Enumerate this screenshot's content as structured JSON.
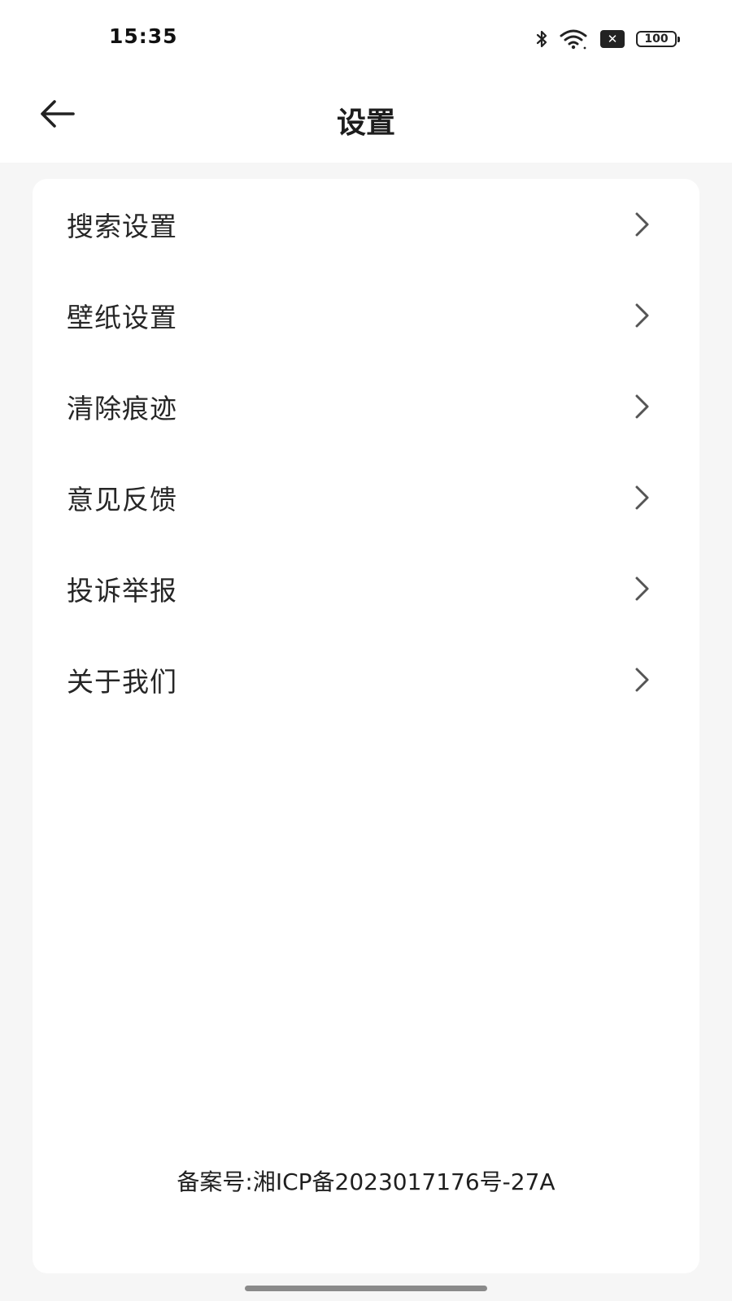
{
  "status_bar": {
    "time": "15:35",
    "battery": "100"
  },
  "header": {
    "title": "设置"
  },
  "menu": {
    "items": [
      {
        "label": "搜索设置"
      },
      {
        "label": "壁纸设置"
      },
      {
        "label": "清除痕迹"
      },
      {
        "label": "意见反馈"
      },
      {
        "label": "投诉举报"
      },
      {
        "label": "关于我们"
      }
    ]
  },
  "footer": {
    "record_number": "备案号:湘ICP备2023017176号-27A"
  },
  "icons": {
    "back": "arrow-left-icon",
    "chevron": "chevron-right-icon",
    "bluetooth": "bluetooth-icon",
    "wifi": "wifi-icon",
    "sim": "no-sim-icon",
    "battery": "battery-icon"
  },
  "colors": {
    "page_background": "#f6f6f6",
    "card_background": "#ffffff",
    "text_primary": "#262626",
    "chevron": "#555555"
  }
}
